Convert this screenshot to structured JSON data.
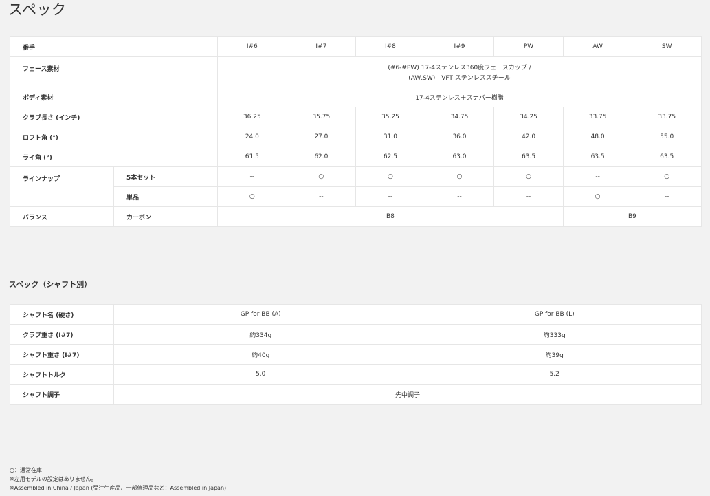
{
  "page_title": "スペック",
  "spec": {
    "header_label": "番手",
    "columns": [
      "I#6",
      "I#7",
      "I#8",
      "I#9",
      "PW",
      "AW",
      "SW"
    ],
    "face_label": "フェース素材",
    "face_line1": "(#6-#PW) 17-4ステンレス360度フェースカップ /",
    "face_line2": "(AW,SW)　VFT ステンレススチール",
    "body_label": "ボディ素材",
    "body_value": "17-4ステンレス＋スナバー樹脂",
    "length_label": "クラブ長さ (インチ)",
    "length": [
      "36.25",
      "35.75",
      "35.25",
      "34.75",
      "34.25",
      "33.75",
      "33.75"
    ],
    "loft_label": "ロフト角 (°)",
    "loft": [
      "24.0",
      "27.0",
      "31.0",
      "36.0",
      "42.0",
      "48.0",
      "55.0"
    ],
    "lie_label": "ライ角 (°)",
    "lie": [
      "61.5",
      "62.0",
      "62.5",
      "63.0",
      "63.5",
      "63.5",
      "63.5"
    ],
    "lineup_label": "ラインナップ",
    "set_label": "5本セット",
    "set_marks": [
      "--",
      "○",
      "○",
      "○",
      "○",
      "--",
      "○"
    ],
    "single_label": "単品",
    "single_marks": [
      "○",
      "--",
      "--",
      "--",
      "--",
      "○",
      "--"
    ],
    "balance_label": "バランス",
    "balance_sub": "カーボン",
    "balance_a": "B8",
    "balance_b": "B9"
  },
  "shaft_section_title": "スペック（シャフト別）",
  "shaft": {
    "name_label": "シャフト名 (硬さ)",
    "name_a": "GP for BB (A)",
    "name_b": "GP for BB (L)",
    "club_weight_label": "クラブ重さ (I#7)",
    "club_weight_a": "約334g",
    "club_weight_b": "約333g",
    "shaft_weight_label": "シャフト重さ (I#7)",
    "shaft_weight_a": "約40g",
    "shaft_weight_b": "約39g",
    "torque_label": "シャフトトルク",
    "torque_a": "5.0",
    "torque_b": "5.2",
    "kick_label": "シャフト調子",
    "kick_value": "先中調子"
  },
  "notes": {
    "line1": "○：通常在庫",
    "line2": "※左用モデルの設定はありません。",
    "line3": "※Assembled in China / Japan (受注生産品、一部修理品など：Assembled in Japan)"
  }
}
